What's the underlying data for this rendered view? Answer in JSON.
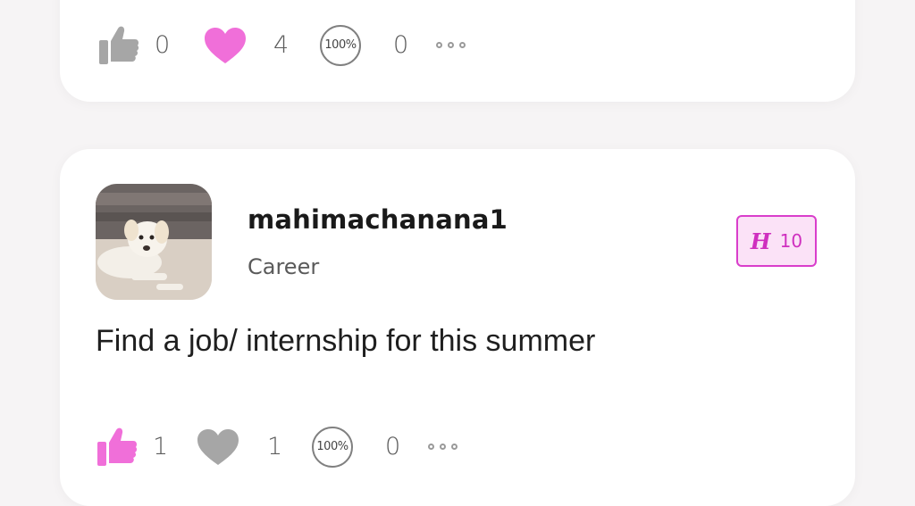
{
  "posts": [
    {
      "reactions": {
        "likes": "0",
        "hearts": "4",
        "percent_label": "100%",
        "percent_count": "0"
      },
      "colors": {
        "like": "#a6a6a6",
        "heart": "#f06fd9"
      }
    },
    {
      "author": "mahimachanana1",
      "category": "Career",
      "badge": {
        "letter": "H",
        "value": "10"
      },
      "text": "Find a job/ internship for this summer",
      "reactions": {
        "likes": "1",
        "hearts": "1",
        "percent_label": "100%",
        "percent_count": "0"
      },
      "colors": {
        "like": "#f06fd9",
        "heart": "#a6a6a6",
        "accent": "#d93ecb"
      }
    }
  ],
  "icons": {
    "like": "thumbs-up-icon",
    "heart": "heart-icon",
    "more": "more-dots-icon",
    "avatar": "avatar-dog-photo"
  }
}
